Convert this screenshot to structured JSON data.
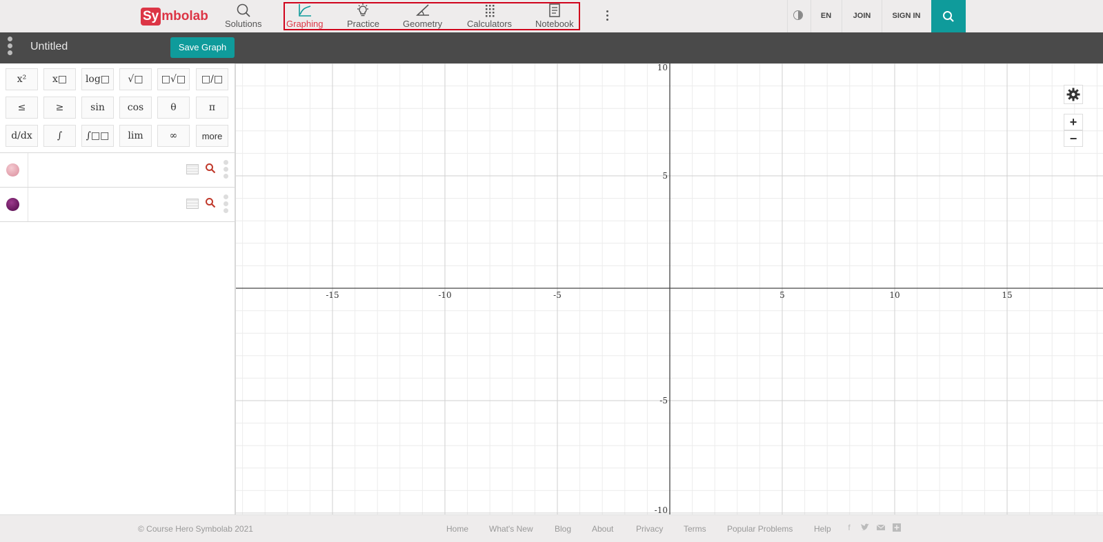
{
  "brand": {
    "logo_box": "Sy",
    "logo_rest": "mbolab"
  },
  "nav": {
    "solutions": "Solutions",
    "graphing": "Graphing",
    "practice": "Practice",
    "geometry": "Geometry",
    "calculators": "Calculators",
    "notebook": "Notebook"
  },
  "header_right": {
    "language": "EN",
    "join": "JOIN",
    "sign_in": "SIGN IN"
  },
  "toolbar": {
    "title": "Untitled",
    "save_label": "Save Graph"
  },
  "keypad": {
    "rows": [
      [
        "x²",
        "x□",
        "log□",
        "√□",
        "□√□",
        "□/□"
      ],
      [
        "≤",
        "≥",
        "sin",
        "cos",
        "θ",
        "π"
      ],
      [
        "d/dx",
        "∫",
        "∫□□",
        "lim",
        "∞",
        "more"
      ]
    ]
  },
  "expressions": [
    {
      "color": "#e8a4b0",
      "value": ""
    },
    {
      "color": "#6a0f5e",
      "value": ""
    }
  ],
  "graph": {
    "x_range": [
      -19,
      19
    ],
    "y_range": [
      -10,
      10
    ],
    "x_ticks": [
      "-15",
      "-10",
      "-5",
      "5",
      "10",
      "15"
    ],
    "y_ticks": [
      "10",
      "5",
      "-5",
      "-10"
    ],
    "accent": "#0f9b9b",
    "brand_red": "#dc3545"
  },
  "footer": {
    "copyright": "© Course Hero Symbolab 2021",
    "links": [
      "Home",
      "What's New",
      "Blog",
      "About",
      "Privacy",
      "Terms",
      "Popular Problems",
      "Help"
    ]
  }
}
